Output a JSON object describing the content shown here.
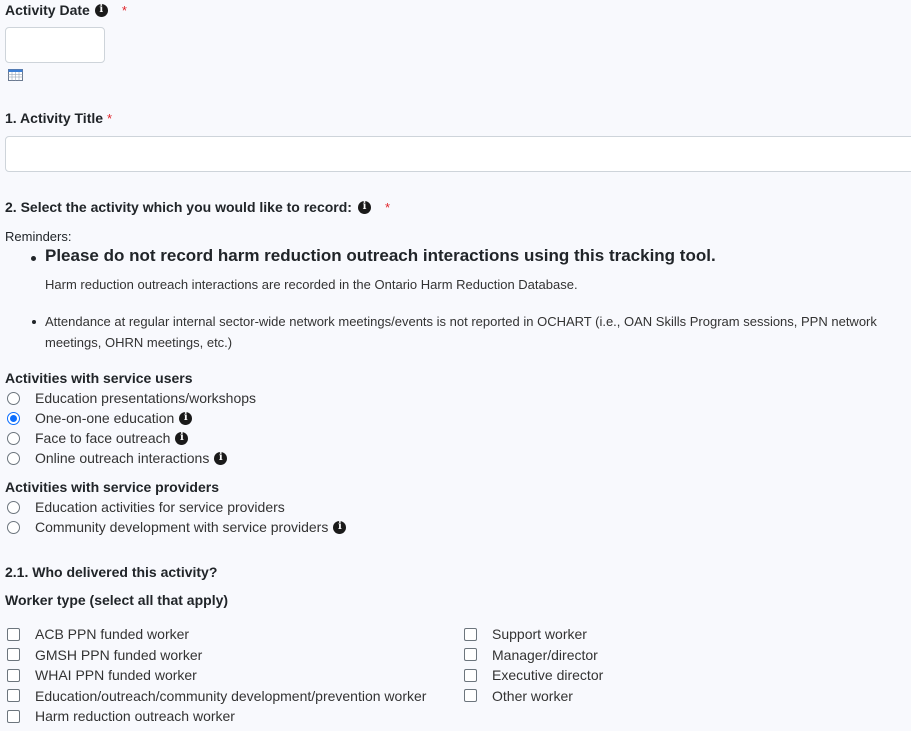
{
  "activity_date": {
    "label": "Activity Date",
    "required_marker": "*",
    "value": "",
    "info_icon": "info-circle-icon",
    "calendar_icon": "calendar-icon"
  },
  "activity_title": {
    "label": "1. Activity Title",
    "required_marker": "*",
    "value": ""
  },
  "select_activity": {
    "label": "2. Select the activity which you would like to record:",
    "required_marker": "*",
    "info_icon": "info-circle-icon"
  },
  "reminders": {
    "heading": "Reminders:",
    "items": [
      {
        "text": "Please do not record harm reduction outreach interactions using this tracking tool.",
        "subtext": "Harm reduction outreach interactions are recorded in the Ontario Harm Reduction Database."
      },
      {
        "text": "Attendance at regular internal sector-wide network meetings/events is not reported in OCHART (i.e., OAN Skills Program sessions, PPN network meetings, OHRN meetings, etc.)"
      }
    ]
  },
  "service_users": {
    "title": "Activities with service users",
    "options": [
      {
        "label": "Education presentations/workshops",
        "checked": false,
        "info": false
      },
      {
        "label": "One-on-one education",
        "checked": true,
        "info": true
      },
      {
        "label": "Face to face outreach",
        "checked": false,
        "info": true
      },
      {
        "label": "Online outreach interactions",
        "checked": false,
        "info": true
      }
    ]
  },
  "service_providers": {
    "title": "Activities with service providers",
    "options": [
      {
        "label": "Education activities for service providers",
        "checked": false,
        "info": false
      },
      {
        "label": "Community development with service providers",
        "checked": false,
        "info": true
      }
    ]
  },
  "who_delivered": {
    "label": "2.1. Who delivered this activity?",
    "worker_type_label": "Worker type (select all that apply)",
    "left_options": [
      {
        "label": "ACB PPN funded worker",
        "checked": false
      },
      {
        "label": "GMSH PPN funded worker",
        "checked": false
      },
      {
        "label": "WHAI PPN funded worker",
        "checked": false
      },
      {
        "label": "Education/outreach/community development/prevention worker",
        "checked": false
      },
      {
        "label": "Harm reduction outreach worker",
        "checked": false
      }
    ],
    "right_options": [
      {
        "label": "Support worker",
        "checked": false
      },
      {
        "label": "Manager/director",
        "checked": false
      },
      {
        "label": "Executive director",
        "checked": false
      },
      {
        "label": "Other worker",
        "checked": false
      }
    ]
  },
  "colors": {
    "accent": "#0d6efd",
    "required": "#e0242a",
    "background": "#f8f9fd"
  }
}
